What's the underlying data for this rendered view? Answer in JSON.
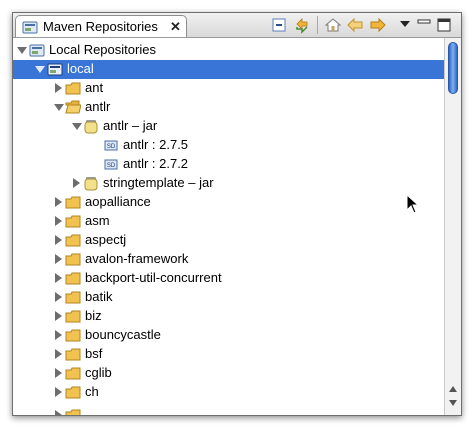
{
  "view": {
    "title": "Maven Repositories",
    "close_glyph": "✕",
    "toolbar": [
      "collapse-all-icon",
      "refresh-icon",
      "home-icon",
      "back-icon",
      "forward-icon",
      "view-menu-icon",
      "minimize-icon",
      "maximize-icon"
    ]
  },
  "tree": {
    "root": "Local Repositories",
    "local": "local",
    "rows": [
      {
        "label": "ant"
      },
      {
        "label": "antlr"
      },
      {
        "label": "antlr – jar"
      },
      {
        "label": "antlr : 2.7.5"
      },
      {
        "label": "antlr : 2.7.2"
      },
      {
        "label": "stringtemplate – jar"
      },
      {
        "label": "aopalliance"
      },
      {
        "label": "asm"
      },
      {
        "label": "aspectj"
      },
      {
        "label": "avalon-framework"
      },
      {
        "label": "backport-util-concurrent"
      },
      {
        "label": "batik"
      },
      {
        "label": "biz"
      },
      {
        "label": "bouncycastle"
      },
      {
        "label": "bsf"
      },
      {
        "label": "cglib"
      },
      {
        "label": "ch"
      }
    ]
  },
  "colors": {
    "selection": "#3875d7",
    "folder": "#f2c250",
    "jar": "#f4e08a"
  }
}
